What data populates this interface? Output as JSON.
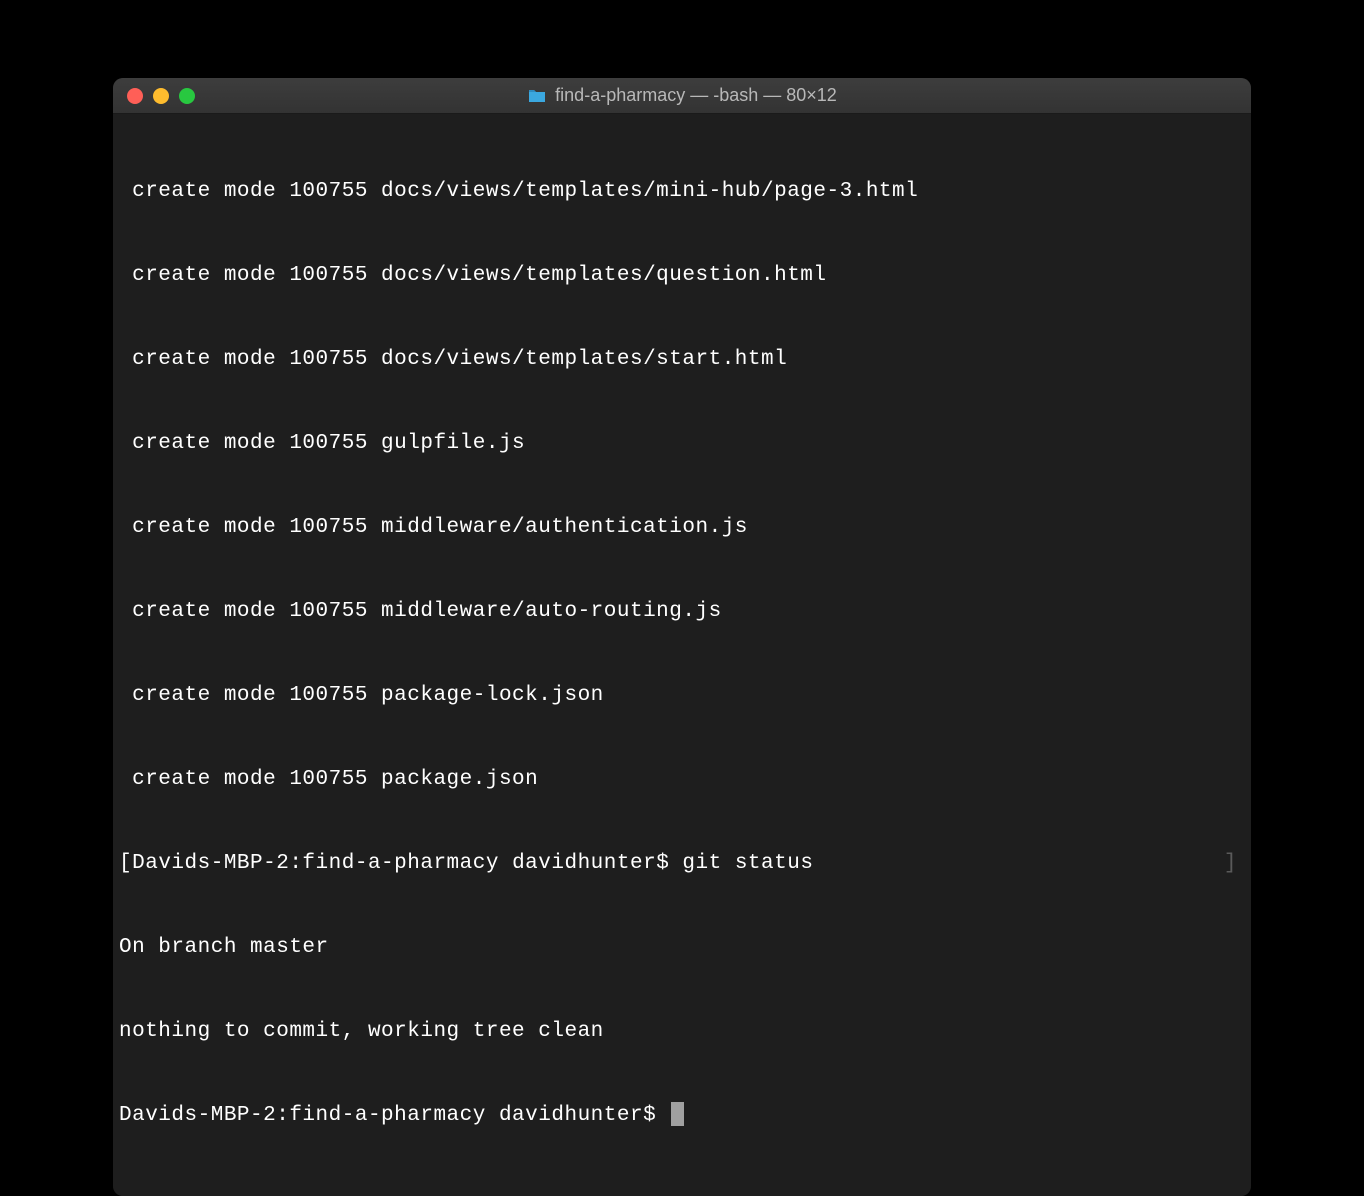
{
  "window": {
    "title": "find-a-pharmacy — -bash — 80×12"
  },
  "output": {
    "lines": [
      " create mode 100755 docs/views/templates/mini-hub/page-3.html",
      " create mode 100755 docs/views/templates/question.html",
      " create mode 100755 docs/views/templates/start.html",
      " create mode 100755 gulpfile.js",
      " create mode 100755 middleware/authentication.js",
      " create mode 100755 middleware/auto-routing.js",
      " create mode 100755 package-lock.json",
      " create mode 100755 package.json"
    ],
    "prompt_bracket_left": "[",
    "prompt_bracket_right": "]",
    "prompt1": "Davids-MBP-2:find-a-pharmacy davidhunter$ ",
    "command1": "git status",
    "status_lines": [
      "On branch master",
      "nothing to commit, working tree clean"
    ],
    "prompt2": "Davids-MBP-2:find-a-pharmacy davidhunter$ "
  }
}
